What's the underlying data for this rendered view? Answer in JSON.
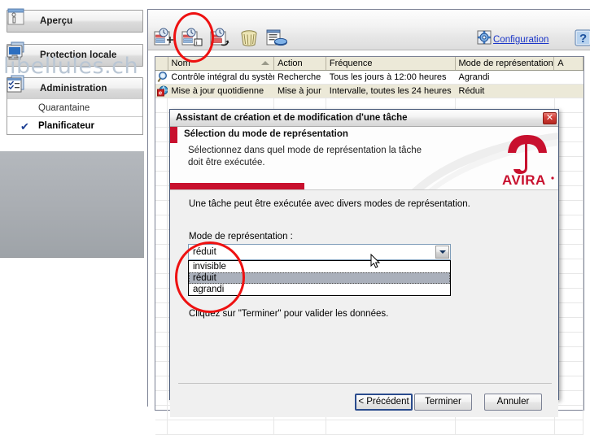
{
  "sidebar": {
    "items": [
      {
        "label": "Aperçu",
        "icon": "overview-info-icon",
        "type": "nav"
      },
      {
        "label": "Protection locale",
        "icon": "monitor-icon",
        "type": "nav"
      },
      {
        "label": "Administration",
        "icon": "checklist-icon",
        "type": "nav"
      }
    ],
    "subitems": [
      {
        "label": "Quarantaine",
        "selected": false
      },
      {
        "label": "Planificateur",
        "selected": true,
        "check": "✔"
      }
    ]
  },
  "toolbar": {
    "buttons": [
      {
        "name": "new-task-icon",
        "title": "Nouvelle tâche"
      },
      {
        "name": "task-properties-icon",
        "title": "Propriétés"
      },
      {
        "name": "modify-task-icon",
        "title": "Modifier la tâche"
      },
      {
        "name": "delete-task-icon",
        "title": "Supprimer"
      },
      {
        "name": "run-task-icon",
        "title": "Exécuter"
      }
    ],
    "config_label": "Configuration",
    "config_icon": "gear-icon",
    "help_icon": "help-question-icon"
  },
  "table": {
    "columns": [
      "",
      "Nom",
      "Action",
      "Fréquence",
      "Mode de représentation",
      "A"
    ],
    "sorted_column": "Nom",
    "rows": [
      {
        "icon": "magnifier-icon",
        "nom": "Contrôle intégral du système",
        "action": "Recherche",
        "frequence": "Tous les jours à 12:00 heures",
        "mode": "Agrandi",
        "a": ""
      },
      {
        "icon": "update-globe-icon",
        "nom": "Mise à jour quotidienne",
        "action": "Mise à jour",
        "frequence": "Intervalle, toutes les 24 heures",
        "mode": "Réduit",
        "a": ""
      }
    ]
  },
  "watermark": "libellules.ch",
  "dialog": {
    "title": "Assistant de création et de modification d'une tâche",
    "close_label": "✕",
    "banner": {
      "heading": "Sélection du mode de représentation",
      "subtext": "Sélectionnez dans quel mode de représentation la tâche doit être exécutée.",
      "logo_text": "AVIRA",
      "logo_icon": "avira-umbrella-icon"
    },
    "intro": "Une tâche peut être exécutée avec divers modes de représentation.",
    "combo_label": "Mode de représentation :",
    "combo": {
      "value": "réduit",
      "expanded": true,
      "options": [
        {
          "label": "invisible",
          "selected": false
        },
        {
          "label": "réduit",
          "selected": true
        },
        {
          "label": "agrandi",
          "selected": false
        }
      ]
    },
    "hint": "Cliquez sur \"Terminer\" pour valider les données.",
    "buttons": {
      "back": "< Précédent",
      "back_accel": "P",
      "finish": "Terminer",
      "cancel": "Annuler"
    }
  },
  "colors": {
    "avira_red": "#c8102e",
    "annotation_red": "#ee1111",
    "link_blue": "#1a35c8",
    "header_beige": "#ece9d8",
    "select_gray": "#aab0bb"
  }
}
